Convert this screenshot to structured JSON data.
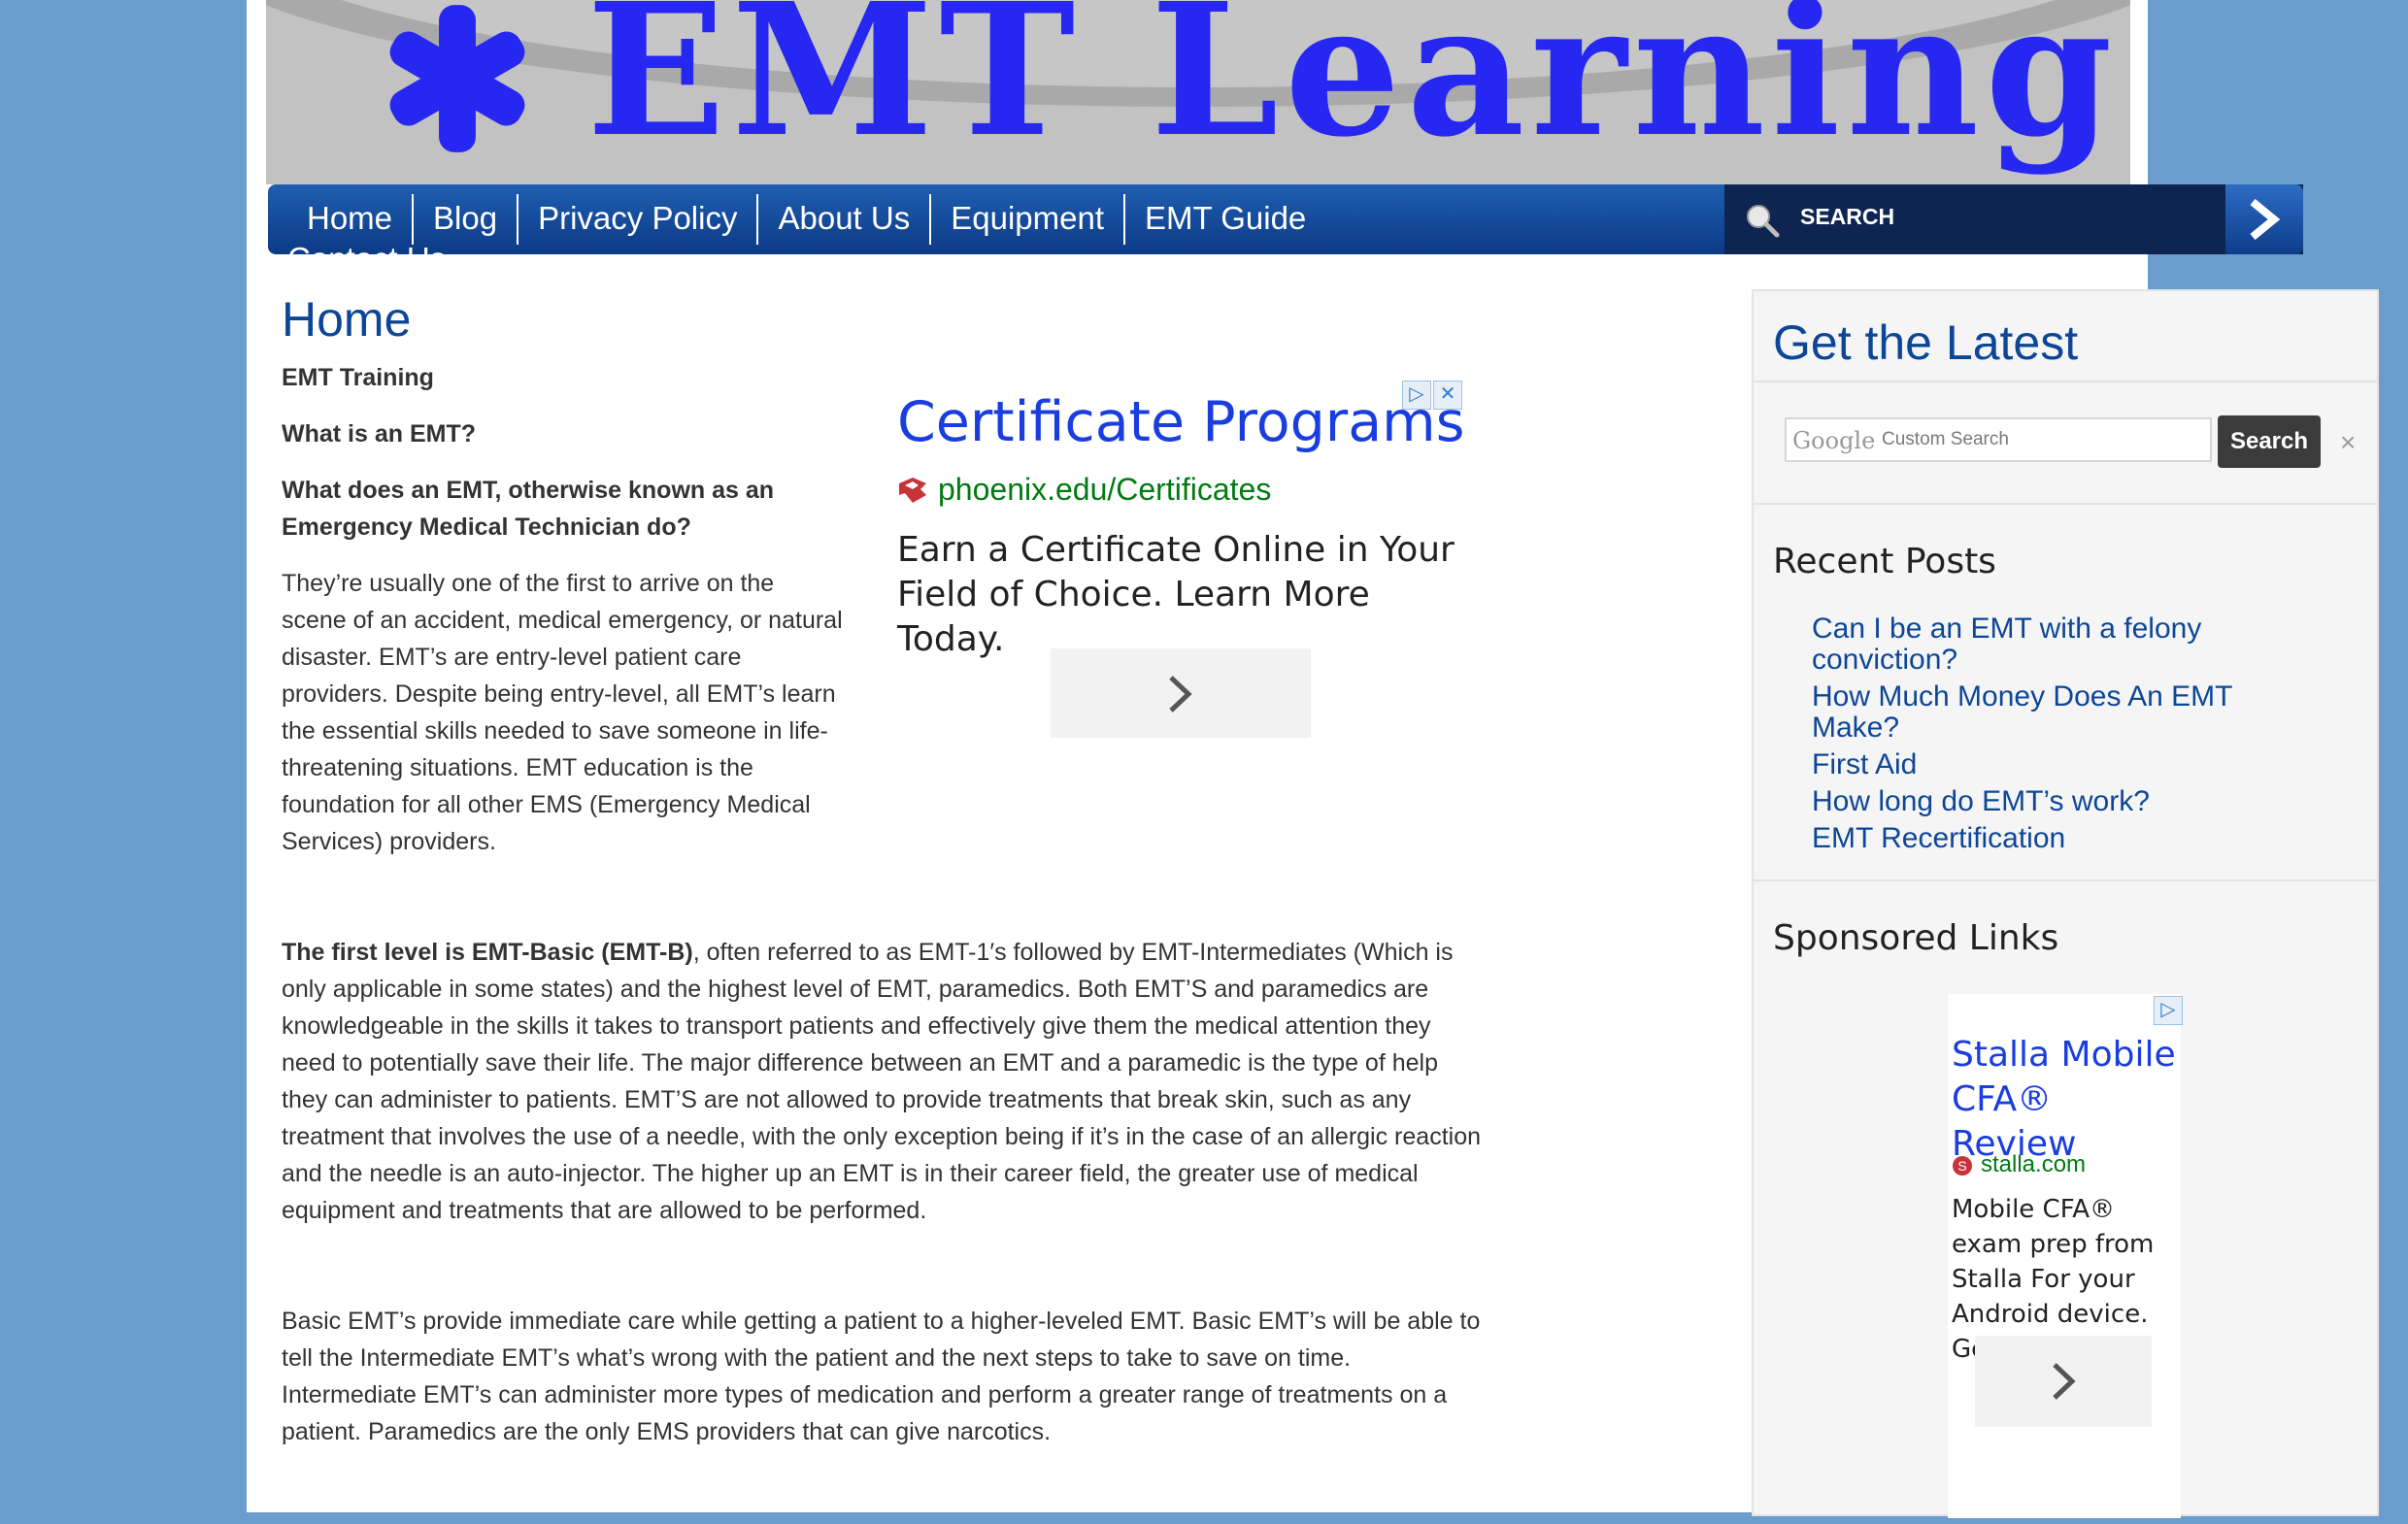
{
  "header": {
    "logo_text": "EMT Learning"
  },
  "nav": {
    "items": [
      {
        "label": "Home"
      },
      {
        "label": "Blog"
      },
      {
        "label": "Privacy Policy"
      },
      {
        "label": "About Us"
      },
      {
        "label": "Equipment"
      },
      {
        "label": "EMT Guide"
      }
    ],
    "overflow_label": "Contact Us",
    "search_label": "SEARCH"
  },
  "main": {
    "title": "Home",
    "heading1": "EMT Training",
    "heading2": "What is an EMT?",
    "heading3": "What does an EMT, otherwise known as an Emergency Medical Technician do?",
    "intro_paragraph": "They’re usually one of the first to arrive on the scene of an accident, medical emergency, or natural disaster.  EMT’s are entry-level patient care providers.  Despite being entry-level, all EMT’s learn the essential skills needed to save someone in life-threatening situations.  EMT education is the foundation for all other EMS (Emergency Medical Services) providers.",
    "para2_bold": "The first level is EMT-Basic (EMT-B)",
    "para2_rest": ", often referred to as EMT-1′s followed by EMT-Intermediates (Which is only applicable in some states) and the highest level of EMT, paramedics. Both EMT’S and paramedics are knowledgeable in the skills it takes to transport patients and effectively give them the medical attention they need to potentially save their life. The major difference between an EMT and a paramedic is the type of help they can administer to patients. EMT’S are not allowed to provide treatments that break skin, such as any treatment that involves the use of a needle, with the only exception being if it’s in the case of an allergic reaction and the needle is an auto-injector. The higher up an EMT is in their career field, the greater use of medical equipment and treatments that are allowed to be performed.",
    "para3": "Basic EMT’s provide immediate care while getting a patient to a higher-leveled EMT. Basic EMT’s will be able to tell the Intermediate EMT’s what’s wrong with the patient and the next steps to take to save on time. Intermediate EMT’s can administer more types of medication and perform a greater range of treatments on a patient. Paramedics are the only EMS providers that can give narcotics."
  },
  "ad1": {
    "title": "Certificate Programs",
    "url": "phoenix.edu/Certificates",
    "description": "Earn a Certificate Online in Your Field of Choice. Learn More Today."
  },
  "sidebar": {
    "latest_title": "Get the Latest",
    "google_logo": "Google",
    "search_placeholder": "Custom Search",
    "search_button": "Search",
    "clear_symbol": "×",
    "recent_title": "Recent Posts",
    "recent_posts": [
      {
        "label": "Can I be an EMT with a felony conviction?"
      },
      {
        "label": "How Much Money Does An EMT Make?"
      },
      {
        "label": "First Aid"
      },
      {
        "label": "How long do EMT’s work?"
      },
      {
        "label": "EMT Recertification"
      }
    ],
    "sponsored_title": "Sponsored Links"
  },
  "ad2": {
    "title": "Stalla Mobile CFA® Review",
    "url": "stalla.com",
    "description": "Mobile CFA® exam prep from Stalla For your Android device. Get app!"
  },
  "colors": {
    "background": "#6a9ccd",
    "nav_blue": "#1f5eb0",
    "link_blue": "#0d4697",
    "ad_title_blue": "#1a3de0",
    "ad_url_green": "#007a11"
  },
  "icons": {
    "logo": "star-of-life-icon",
    "search": "magnifier-icon",
    "go": "chevron-right-icon",
    "ad_choices": "adchoices-icon",
    "ad_close": "close-icon"
  }
}
